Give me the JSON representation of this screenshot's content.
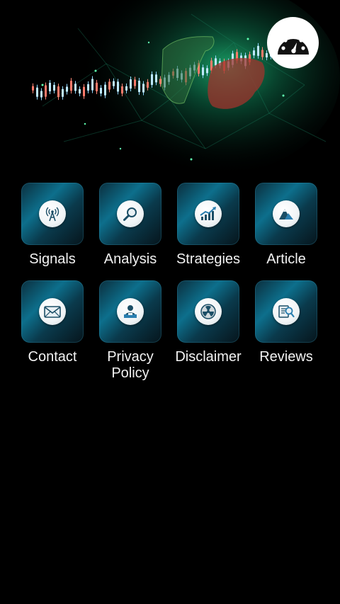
{
  "header": {
    "banner_icon": "bull-bear-market-chart",
    "gauge_icon": "speedometer-icon"
  },
  "menu": {
    "items": [
      {
        "label": "Signals",
        "icon": "antenna-icon"
      },
      {
        "label": "Analysis",
        "icon": "magnifier-icon"
      },
      {
        "label": "Strategies",
        "icon": "growth-chart-icon"
      },
      {
        "label": "Article",
        "icon": "mountain-logo-icon"
      },
      {
        "label": "Contact",
        "icon": "envelope-icon"
      },
      {
        "label": "Privacy\nPolicy",
        "icon": "user-desk-icon"
      },
      {
        "label": "Disclaimer",
        "icon": "radiation-icon"
      },
      {
        "label": "Reviews",
        "icon": "document-search-icon"
      }
    ]
  },
  "colors": {
    "background": "#000000",
    "tile_accent": "#0d6f8c",
    "label_text": "#f2f2f2"
  }
}
